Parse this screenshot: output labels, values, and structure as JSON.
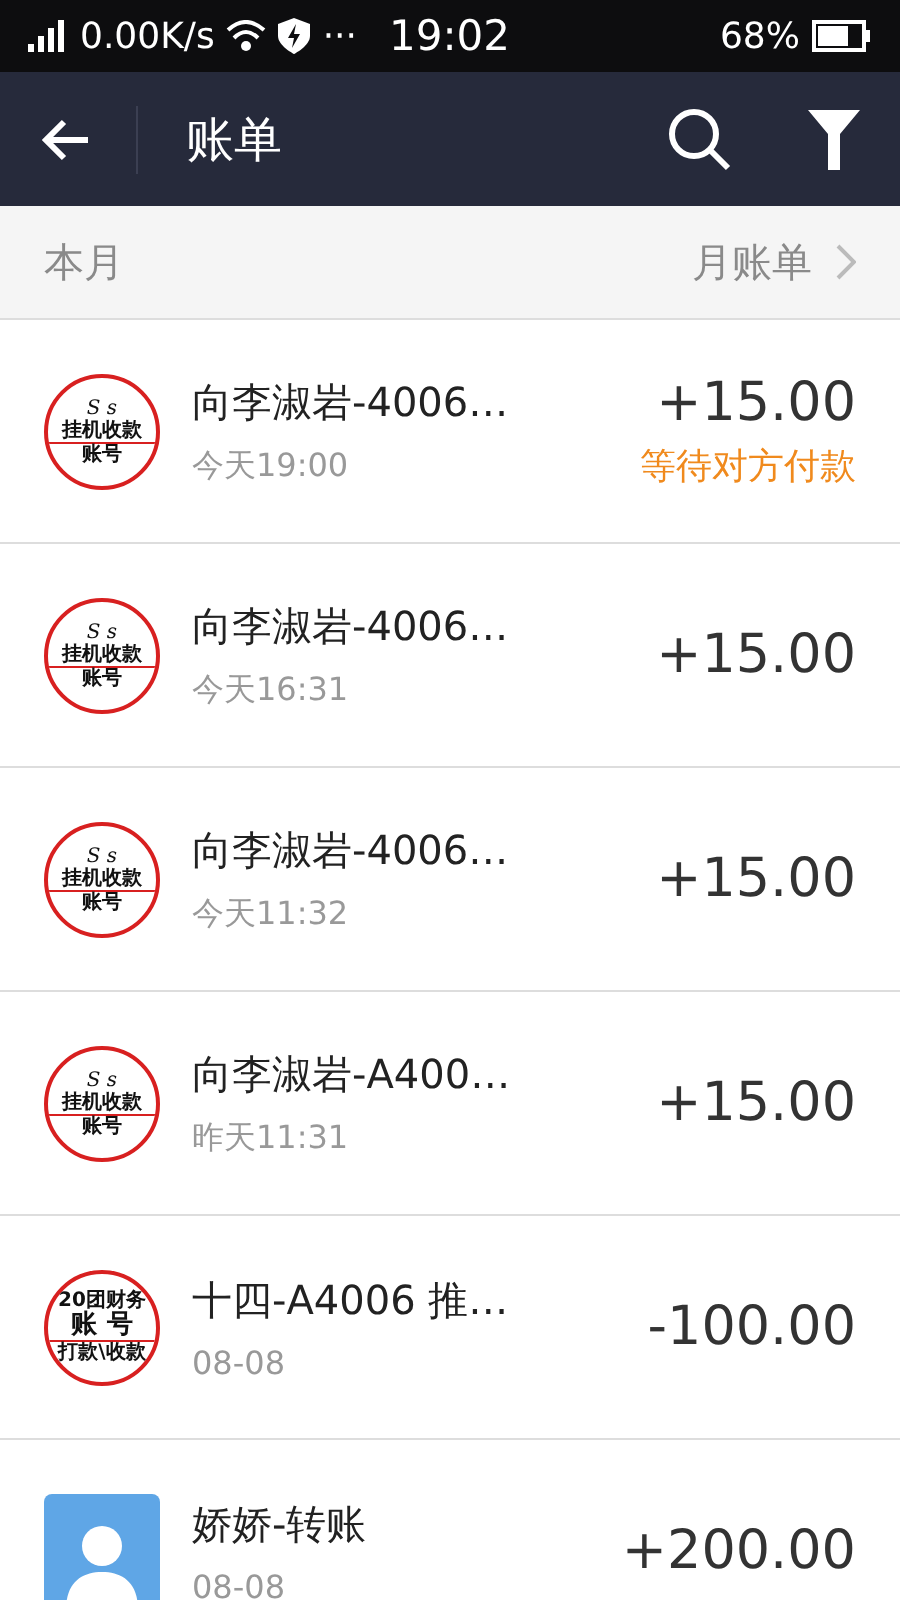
{
  "status_bar": {
    "speed": "0.00K/s",
    "dots": "···",
    "time": "19:02",
    "battery": "68%"
  },
  "header": {
    "title": "账单"
  },
  "month_bar": {
    "label": "本月",
    "link": "月账单"
  },
  "items": [
    {
      "avatar": {
        "kind": "stamp_a",
        "lines": [
          "S s",
          "挂机收款",
          "账号"
        ]
      },
      "title": "向李淑岩-4006…",
      "time": "今天19:00",
      "amount": "+15.00",
      "status": "等待对方付款"
    },
    {
      "avatar": {
        "kind": "stamp_a",
        "lines": [
          "S s",
          "挂机收款",
          "账号"
        ]
      },
      "title": "向李淑岩-4006…",
      "time": "今天16:31",
      "amount": "+15.00"
    },
    {
      "avatar": {
        "kind": "stamp_a",
        "lines": [
          "S s",
          "挂机收款",
          "账号"
        ]
      },
      "title": "向李淑岩-4006…",
      "time": "今天11:32",
      "amount": "+15.00"
    },
    {
      "avatar": {
        "kind": "stamp_a",
        "lines": [
          "S s",
          "挂机收款",
          "账号"
        ]
      },
      "title": "向李淑岩-A400…",
      "time": "昨天11:31",
      "amount": "+15.00"
    },
    {
      "avatar": {
        "kind": "stamp_b",
        "lines": [
          "20团财务",
          "账 号",
          "打款\\收款"
        ]
      },
      "title": "十四-A4006 推…",
      "time": "08-08",
      "amount": "-100.00"
    },
    {
      "avatar": {
        "kind": "person"
      },
      "title": "娇娇-转账",
      "time": "08-08",
      "amount": "+200.00"
    }
  ]
}
